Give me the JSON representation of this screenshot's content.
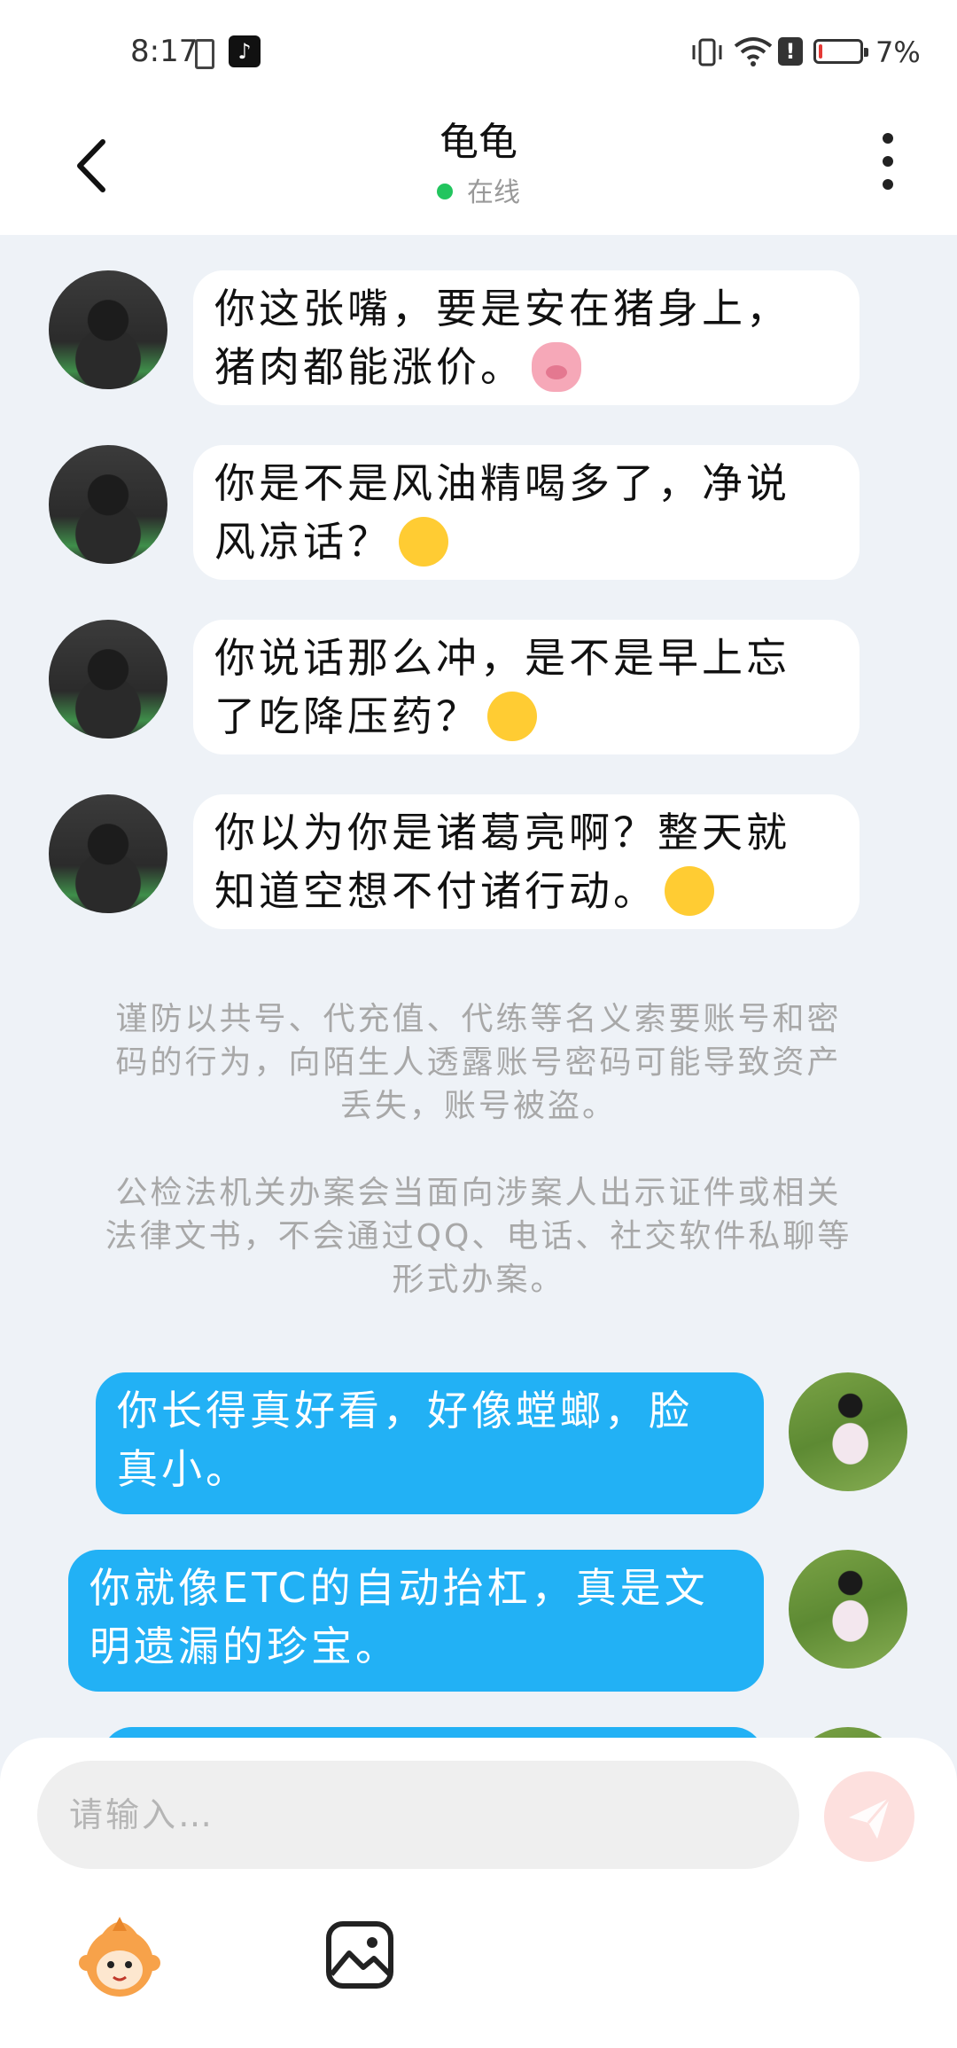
{
  "status_bar": {
    "time": "8:17",
    "battery_percent": "7%",
    "tiktok_glyph": "♪",
    "alert_glyph": "!",
    "icons": [
      "battery-small-icon",
      "tiktok-icon",
      "vibrate-icon",
      "wifi-icon",
      "alert-icon",
      "battery-icon"
    ]
  },
  "header": {
    "title": "龟龟",
    "status": "在线",
    "status_color": "#22c55e"
  },
  "messages_in": [
    {
      "line1": "你这张嘴，要是安在猪身上，",
      "line2": "猪肉都能涨价。",
      "emoji": "pig-face"
    },
    {
      "line1": "你是不是风油精喝多了，净说",
      "line2": "风凉话？",
      "emoji": "zany-face"
    },
    {
      "line1": "你说话那么冲，是不是早上忘",
      "line2": "了吃降压药？",
      "emoji": "upside-down-face"
    },
    {
      "line1": "你以为你是诸葛亮啊？整天就",
      "line2": "知道空想不付诸行动。",
      "emoji": "thinking-face"
    }
  ],
  "notices": [
    {
      "line1": "谨防以共号、代充值、代练等名义索要账号和密",
      "line2": "码的行为，向陌生人透露账号密码可能导致资产",
      "line3": "丢失，账号被盗。"
    },
    {
      "line1": "公检法机关办案会当面向涉案人出示证件或相关",
      "line2": "法律文书，不会通过QQ、电话、社交软件私聊等",
      "line3": "形式办案。"
    }
  ],
  "messages_out": [
    {
      "line1": "你长得真好看，好像螳螂，脸",
      "line2": "真小。"
    },
    {
      "line1": "你就像ETC的自动抬杠，真是文",
      "line2": "明遗漏的珍宝。"
    }
  ],
  "composer": {
    "placeholder": "请输入…",
    "send_color": "#fde0de",
    "accent_out": "#22b1f5"
  }
}
